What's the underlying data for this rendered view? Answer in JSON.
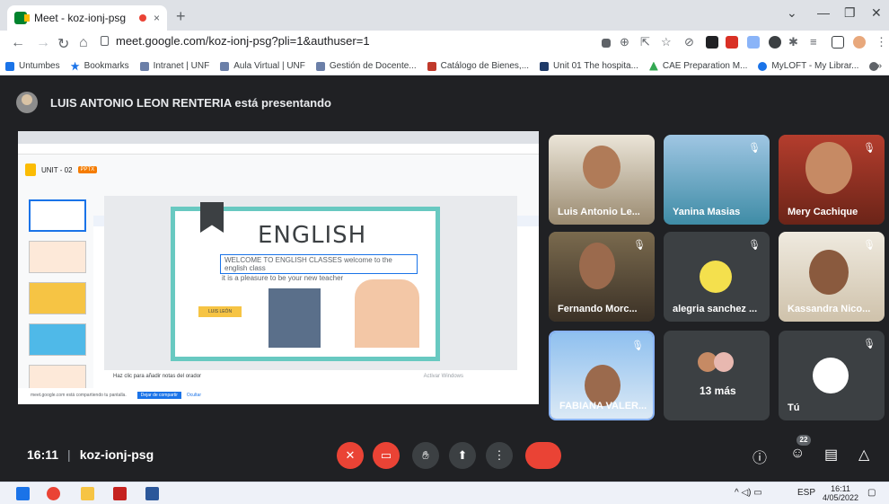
{
  "browser": {
    "tab_title": "Meet - koz-ionj-psg",
    "tab_close": "×",
    "new_tab": "+",
    "url": "meet.google.com/koz-ionj-psg?pli=1&authuser=1",
    "bookmarks": [
      {
        "label": "Untumbes",
        "icon": "bookmark-star-icon",
        "color": "#1a73e8"
      },
      {
        "label": "Bookmarks",
        "icon": "star-icon",
        "color": "#1a73e8"
      },
      {
        "label": "Intranet | UNF",
        "icon": "page-icon",
        "color": "#6b7fa8"
      },
      {
        "label": "Aula Virtual | UNF",
        "icon": "page-icon",
        "color": "#6b7fa8"
      },
      {
        "label": "Gestión de Docente...",
        "icon": "page-icon",
        "color": "#6b7fa8"
      },
      {
        "label": "Catálogo de Bienes,...",
        "icon": "shield-icon",
        "color": "#c0392b"
      },
      {
        "label": "Unit 01 The hospita...",
        "icon": "o-icon",
        "color": "#1f3a68"
      },
      {
        "label": "CAE Preparation M...",
        "icon": "drive-icon",
        "color": "#34a853"
      },
      {
        "label": "MyLOFT - My Librar...",
        "icon": "heart-icon",
        "color": "#1a73e8"
      }
    ],
    "more_bookmarks": "»"
  },
  "meet": {
    "presenter_text": "LUIS ANTONIO LEON RENTERIA está presentando",
    "shared_screen": {
      "doc_title": "UNIT - 02",
      "doc_badge": "PPTX",
      "slide_title": "ENGLISH",
      "slide_line1": "WELCOME TO ENGLISH CLASSES welcome to the english class",
      "slide_line2": "it is a pleasure to be your new teacher",
      "slide_name_tag": "LUIS LEÓN",
      "notes_hint": "Haz clic para añadir notas del orador",
      "share_bar_text": "meet.google.com está compartiendo tu pantalla.",
      "stop_sharing": "Dejar de compartir",
      "hide": "Ocultar",
      "watermark": "Activar Windows"
    },
    "participants": [
      {
        "name": "Luis Antonio Le...",
        "muted": false
      },
      {
        "name": "Yanina Masias",
        "muted": true
      },
      {
        "name": "Mery Cachique",
        "muted": true
      },
      {
        "name": "Fernando Morc...",
        "muted": true
      },
      {
        "name": "alegria sanchez ...",
        "muted": true
      },
      {
        "name": "Kassandra Nico...",
        "muted": true
      },
      {
        "name": "FABIANA VALER...",
        "muted": true
      },
      {
        "name": "13 más",
        "muted": false
      },
      {
        "name": "Tú",
        "muted": true
      }
    ],
    "time": "16:11",
    "meeting_code": "koz-ionj-psg",
    "participant_count": "22"
  },
  "taskbar": {
    "lang": "ESP",
    "clock_time": "16:11",
    "clock_date": "4/05/2022"
  }
}
